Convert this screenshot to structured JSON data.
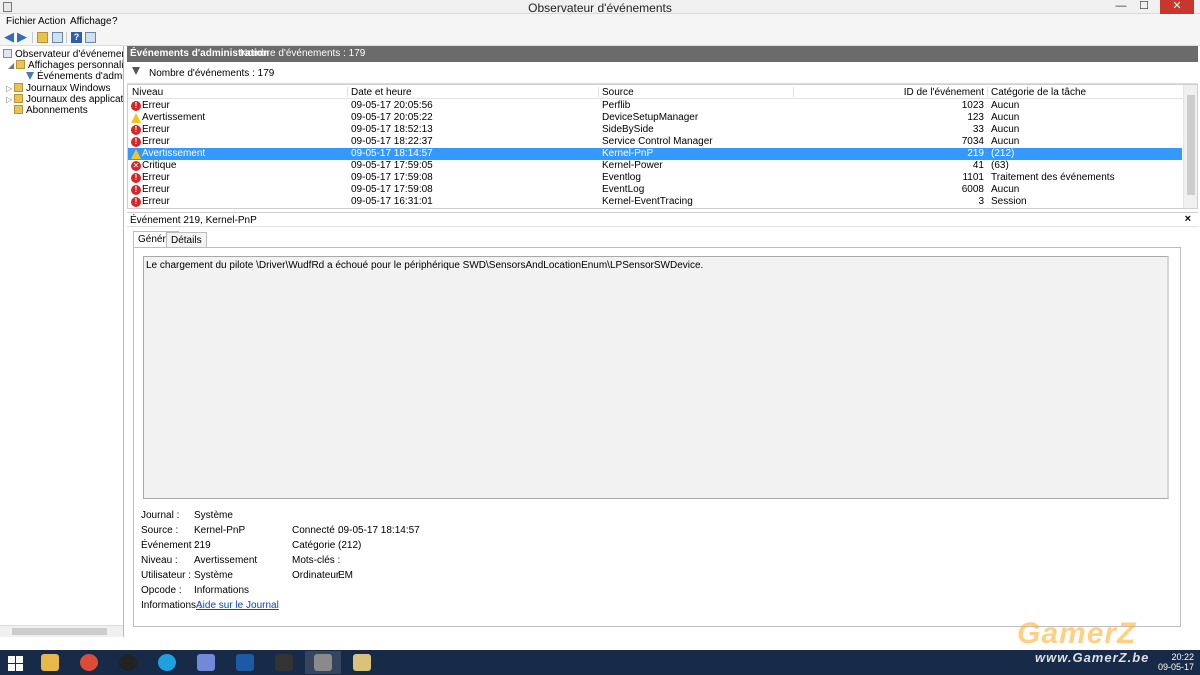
{
  "window": {
    "title": "Observateur d'événements",
    "minimize": "—",
    "maximize": "☐",
    "close": "✕"
  },
  "menu": [
    "Fichier",
    "Action",
    "Affichage",
    "?"
  ],
  "tree": {
    "root": "Observateur d'événements (Loca",
    "custom_views": "Affichages personnalisés",
    "admin_events": "Événements d'administra",
    "windows_logs": "Journaux Windows",
    "apps_logs": "Journaux des applications et",
    "subscriptions": "Abonnements"
  },
  "panel": {
    "title": "Événements d'administration",
    "count": "Nombre d'événements : 179",
    "filter_text": "Nombre d'événements : 179"
  },
  "grid": {
    "columns": [
      "Niveau",
      "Date et heure",
      "Source",
      "ID de l'événement",
      "Catégorie de la tâche"
    ],
    "rows": [
      {
        "level_type": "err",
        "level": "Erreur",
        "date": "09-05-17 20:05:56",
        "source": "Perflib",
        "id": "1023",
        "category": "Aucun"
      },
      {
        "level_type": "warn",
        "level": "Avertissement",
        "date": "09-05-17 20:05:22",
        "source": "DeviceSetupManager",
        "id": "123",
        "category": "Aucun"
      },
      {
        "level_type": "err",
        "level": "Erreur",
        "date": "09-05-17 18:52:13",
        "source": "SideBySide",
        "id": "33",
        "category": "Aucun"
      },
      {
        "level_type": "err",
        "level": "Erreur",
        "date": "09-05-17 18:22:37",
        "source": "Service Control Manager",
        "id": "7034",
        "category": "Aucun"
      },
      {
        "level_type": "warn",
        "level": "Avertissement",
        "date": "09-05-17 18:14:57",
        "source": "Kernel-PnP",
        "id": "219",
        "category": "(212)",
        "selected": true
      },
      {
        "level_type": "crit",
        "level": "Critique",
        "date": "09-05-17 17:59:05",
        "source": "Kernel-Power",
        "id": "41",
        "category": "(63)"
      },
      {
        "level_type": "err",
        "level": "Erreur",
        "date": "09-05-17 17:59:08",
        "source": "Eventlog",
        "id": "1101",
        "category": "Traitement des événements"
      },
      {
        "level_type": "err",
        "level": "Erreur",
        "date": "09-05-17 17:59:08",
        "source": "EventLog",
        "id": "6008",
        "category": "Aucun"
      },
      {
        "level_type": "err",
        "level": "Erreur",
        "date": "09-05-17 16:31:01",
        "source": "Kernel-EventTracing",
        "id": "3",
        "category": "Session"
      }
    ]
  },
  "detail": {
    "title": "Événement 219, Kernel-PnP",
    "close": "×",
    "tabs": [
      "Général",
      "Détails"
    ],
    "description": "Le chargement du pilote \\Driver\\WudfRd a échoué pour le périphérique SWD\\SensorsAndLocationEnum\\LPSensorSWDevice.",
    "fields": {
      "journal_label": "Journal :",
      "journal": "Système",
      "source_label": "Source :",
      "source": "Kernel-PnP",
      "event_label": "Événement :",
      "event": "219",
      "level_label": "Niveau :",
      "level": "Avertissement",
      "user_label": "Utilisateur :",
      "user": "Système",
      "opcode_label": "Opcode :",
      "opcode": "Informations",
      "info_label": "Informations :",
      "info_link": "Aide sur le Journal",
      "logged_label": "Connecté :",
      "logged": "09-05-17 18:14:57",
      "category_label": "Catégorie :",
      "category": "(212)",
      "keywords_label": "Mots-clés :",
      "keywords": "",
      "computer_label": "Ordinateur :",
      "computer": "EM"
    }
  },
  "taskbar": {
    "time": "20:22",
    "date": "09-05-17",
    "apps": [
      {
        "name": "explorer",
        "color": "#e8b84a"
      },
      {
        "name": "chrome",
        "color": "#dd4b39"
      },
      {
        "name": "ubisoft",
        "color": "#222222"
      },
      {
        "name": "skype",
        "color": "#1fa0e0"
      },
      {
        "name": "discord",
        "color": "#7289da"
      },
      {
        "name": "battlenet",
        "color": "#1c5aa6"
      },
      {
        "name": "aion",
        "color": "#333333"
      },
      {
        "name": "event-viewer",
        "color": "#8a8a8a"
      },
      {
        "name": "paint",
        "color": "#d9c27a"
      }
    ]
  },
  "watermark": {
    "line1": "GamerZ",
    "line2": "www.GamerZ.be"
  }
}
